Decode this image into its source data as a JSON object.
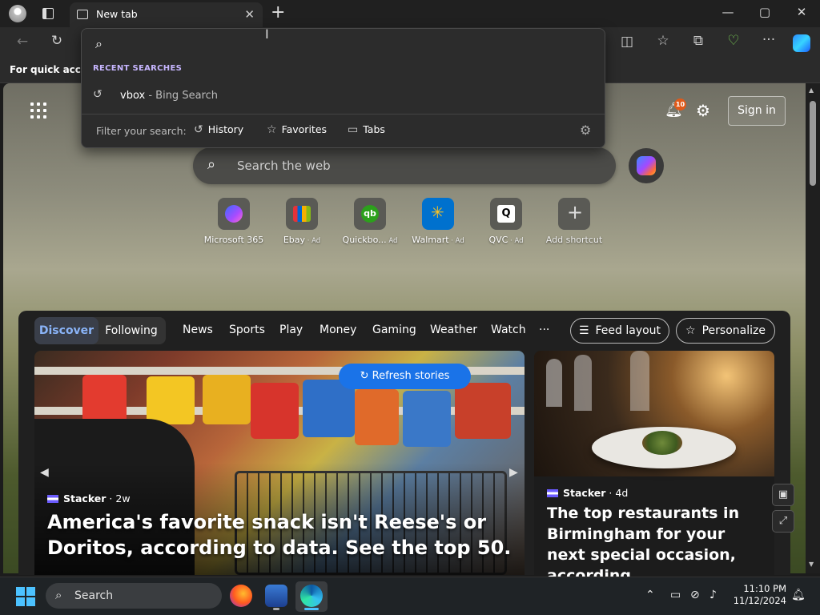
{
  "window": {
    "tab_title": "New tab",
    "tab_close": "✕",
    "new_tab": "+",
    "minimize": "—",
    "maximize": "▢",
    "close": "✕"
  },
  "toolbar": {
    "back": "←",
    "refresh": "↻",
    "split": "◫",
    "favorites": "☆",
    "collections": "⧉",
    "health": "♡",
    "more": "···"
  },
  "favorites_bar": {
    "hint": "For quick access"
  },
  "omnibox": {
    "section_title": "RECENT SEARCHES",
    "recent": [
      {
        "query": "vbox",
        "engine": " - Bing Search"
      }
    ],
    "filter_label": "Filter your search:",
    "filters": [
      "History",
      "Favorites",
      "Tabs"
    ]
  },
  "ntp": {
    "notifications_count": "10",
    "sign_in": "Sign in",
    "search_placeholder": "Search the web",
    "shortcuts": [
      {
        "label": "Microsoft 365",
        "ad": ""
      },
      {
        "label": "Ebay",
        "ad": " · Ad"
      },
      {
        "label": "Quickbo...",
        "ad": " Ad"
      },
      {
        "label": "Walmart",
        "ad": " · Ad"
      },
      {
        "label": "QVC",
        "ad": " · Ad"
      },
      {
        "label": "Add shortcut",
        "ad": ""
      }
    ]
  },
  "feed": {
    "pills": {
      "discover": "Discover",
      "following": "Following"
    },
    "tabs": [
      "News",
      "Sports",
      "Play",
      "Money",
      "Gaming",
      "Weather",
      "Watch",
      "···"
    ],
    "feed_layout": "Feed layout",
    "personalize": "Personalize",
    "refresh": "Refresh stories",
    "main_card": {
      "source": "Stacker",
      "age": " · 2w",
      "headline": "America's favorite snack isn't Reese's or Doritos, according to data. See the top 50."
    },
    "side_card": {
      "source": "Stacker",
      "age": " · 4d",
      "headline": "The top restaurants in Birmingham for your next special occasion, according..."
    }
  },
  "taskbar": {
    "search": "Search",
    "time": "11:10 PM",
    "date": "11/12/2024"
  },
  "colors": {
    "accent": "#1a73e8",
    "discover_text": "#8ab4f8",
    "badge": "#e05a1a"
  }
}
